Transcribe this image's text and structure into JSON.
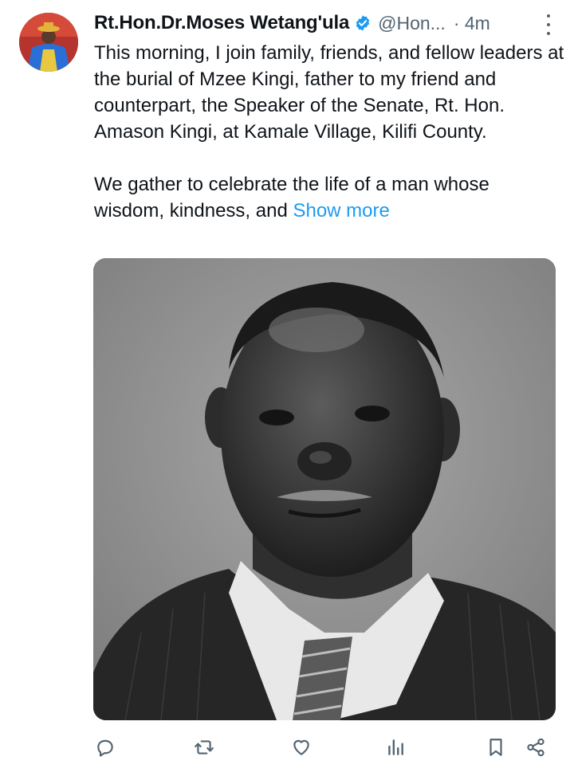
{
  "tweet": {
    "author_name": "Rt.Hon.Dr.Moses Wetang'ula",
    "handle": "@Hon...",
    "time": "· 4m",
    "text_para1": "This morning, I join family, friends, and fellow leaders at the burial of Mzee Kingi, father to my friend and counterpart, the Speaker of the Senate, Rt. Hon. Amason Kingi, at Kamale Village, Kilifi County.",
    "text_para2": "We gather to celebrate the life of a man whose wisdom, kindness, and",
    "show_more": "Show more"
  },
  "icons": {
    "verified": "verified-badge-icon",
    "more": "more-vertical-icon",
    "reply": "reply-icon",
    "retweet": "retweet-icon",
    "like": "like-icon",
    "views": "views-icon",
    "bookmark": "bookmark-icon",
    "share": "share-icon"
  },
  "colors": {
    "link": "#1d9bf0",
    "secondary_text": "#536471",
    "primary_text": "#0f1419",
    "icon": "#536471"
  }
}
